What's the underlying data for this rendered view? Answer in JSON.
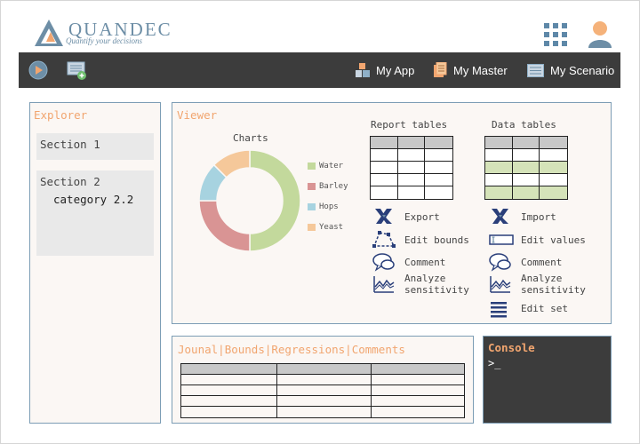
{
  "header": {
    "logo_title": "QUANDEC",
    "logo_subtitle": "Quantify your decisions"
  },
  "toolbar": {
    "items": [
      {
        "label": "My App",
        "icon": "app-blocks-icon"
      },
      {
        "label": "My Master",
        "icon": "documents-icon"
      },
      {
        "label": "My Scenario",
        "icon": "scenario-list-icon"
      }
    ]
  },
  "explorer": {
    "title": "Explorer",
    "sections": [
      {
        "title": "Section 1"
      },
      {
        "title": "Section 2",
        "category": "category 2.2"
      }
    ]
  },
  "viewer": {
    "title": "Viewer",
    "charts_label": "Charts",
    "report_tables_label": "Report tables",
    "data_tables_label": "Data tables",
    "report_actions": [
      {
        "label": "Export",
        "icon": "excel-export-icon"
      },
      {
        "label": "Edit bounds",
        "icon": "edit-bounds-icon"
      },
      {
        "label": "Comment",
        "icon": "comment-icon"
      },
      {
        "label": "Analyze sensitivity",
        "icon": "sensitivity-chart-icon"
      }
    ],
    "data_actions": [
      {
        "label": "Import",
        "icon": "excel-import-icon"
      },
      {
        "label": "Edit values",
        "icon": "edit-values-icon"
      },
      {
        "label": "Comment",
        "icon": "comment-icon"
      },
      {
        "label": "Analyze sensitivity",
        "icon": "sensitivity-chart-icon"
      },
      {
        "label": "Edit set",
        "icon": "list-lines-icon"
      }
    ]
  },
  "chart_data": {
    "type": "pie",
    "categories": [
      "Water",
      "Barley",
      "Hops",
      "Yeast"
    ],
    "values": [
      50,
      25,
      12.5,
      12.5
    ],
    "colors": [
      "#c3d99c",
      "#d99494",
      "#a7d3e0",
      "#f5c89a"
    ],
    "donut": true,
    "legend": "right"
  },
  "journal": {
    "tabs": [
      "Jounal",
      "Bounds",
      "Regressions",
      "Comments"
    ]
  },
  "console": {
    "title": "Console",
    "prompt": ">_"
  }
}
